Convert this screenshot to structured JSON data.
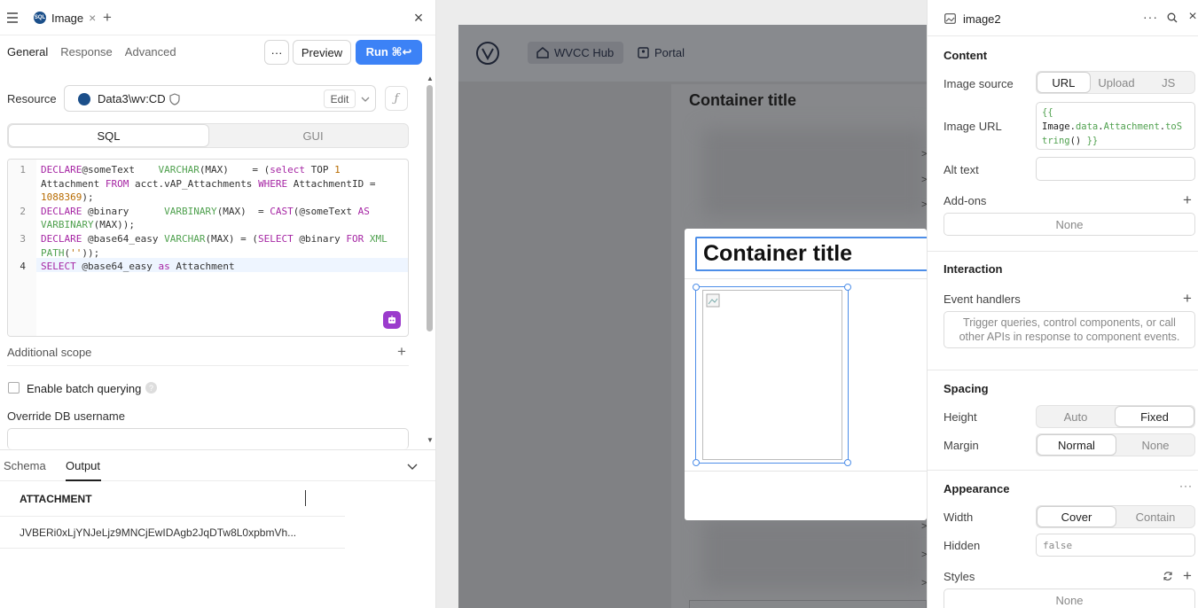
{
  "query_tab": {
    "badge": "SQL",
    "name": "Image"
  },
  "subtabs": [
    "General",
    "Response",
    "Advanced"
  ],
  "toolbar": {
    "more": "···",
    "preview": "Preview",
    "run": "Run ⌘↩"
  },
  "resource": {
    "label": "Resource",
    "value": "Data3\\wv:CD",
    "edit": "Edit"
  },
  "mode": {
    "sql": "SQL",
    "gui": "GUI"
  },
  "editor": {
    "line_numbers": [
      "1",
      "2",
      "3",
      "4"
    ],
    "lines": [
      [
        [
          "kw",
          "DECLARE"
        ],
        [
          "",
          "@someText    "
        ],
        [
          "ty",
          "VARCHAR"
        ],
        [
          "",
          "(MAX)    = ("
        ],
        [
          "kw",
          "select"
        ],
        [
          "",
          " TOP "
        ],
        [
          "num",
          "1"
        ]
      ],
      [
        [
          "",
          "Attachment "
        ],
        [
          "kw",
          "FROM"
        ],
        [
          "",
          " acct.vAP_Attachments "
        ],
        [
          "kw",
          "WHERE"
        ],
        [
          "",
          " AttachmentID ="
        ]
      ],
      [
        [
          "num",
          "1088369"
        ],
        [
          "",
          ");"
        ]
      ],
      [
        [
          "kw",
          "DECLARE"
        ],
        [
          "",
          " @binary      "
        ],
        [
          "ty",
          "VARBINARY"
        ],
        [
          "",
          "(MAX)  = "
        ],
        [
          "kw",
          "CAST"
        ],
        [
          "",
          "(@someText "
        ],
        [
          "kw",
          "AS"
        ]
      ],
      [
        [
          "ty",
          "VARBINARY"
        ],
        [
          "",
          "(MAX));"
        ]
      ],
      [
        [
          "kw",
          "DECLARE"
        ],
        [
          "",
          " @base64_easy "
        ],
        [
          "ty",
          "VARCHAR"
        ],
        [
          "",
          "(MAX) = ("
        ],
        [
          "kw",
          "SELECT"
        ],
        [
          "",
          " @binary "
        ],
        [
          "kw",
          "FOR"
        ],
        [
          "",
          " "
        ],
        [
          "ty",
          "XML"
        ]
      ],
      [
        [
          "ty",
          "PATH"
        ],
        [
          "",
          "("
        ],
        [
          "fn",
          "''"
        ],
        [
          "",
          "));"
        ]
      ],
      [
        [
          "kw",
          "SELECT"
        ],
        [
          "",
          " @base64_easy "
        ],
        [
          "kw",
          "as"
        ],
        [
          "",
          " Attachment"
        ]
      ]
    ]
  },
  "additional_scope": "Additional scope",
  "batch": "Enable batch querying",
  "override": "Override DB username",
  "output_tabs": {
    "schema": "Schema",
    "output": "Output"
  },
  "results": {
    "column": "ATTACHMENT",
    "row": "JVBERi0xLjYNJeLjz9MNCjEwIDAgb2JqDTw8L0xpbmVh..."
  },
  "canvas": {
    "hub": "WVCC Hub",
    "portal": "Portal",
    "container_title_bg": "Container title",
    "container_title": "Container title"
  },
  "inspector": {
    "name": "image2",
    "content": "Content",
    "image_source": {
      "label": "Image source",
      "options": [
        "URL",
        "Upload",
        "JS"
      ],
      "selected": "URL"
    },
    "image_url": {
      "label": "Image URL",
      "value_lines": [
        [
          "ty",
          "{{"
        ],
        [
          "",
          "Image."
        ],
        [
          "ty",
          "data"
        ],
        [
          "",
          "."
        ],
        [
          "ty",
          "Attachment"
        ],
        [
          "",
          "."
        ],
        [
          "ty",
          "toS"
        ]
      ],
      "value_line3": [
        [
          "ty",
          "tring"
        ],
        [
          "",
          "() "
        ],
        [
          "ty",
          "}}"
        ]
      ]
    },
    "alt_text": "Alt text",
    "addons": {
      "label": "Add-ons",
      "value": "None"
    },
    "interaction": "Interaction",
    "event_handlers": {
      "label": "Event handlers",
      "hint": "Trigger queries, control components, or call other APIs in response to component events."
    },
    "spacing": "Spacing",
    "height": {
      "label": "Height",
      "options": [
        "Auto",
        "Fixed"
      ],
      "selected": "Fixed"
    },
    "margin": {
      "label": "Margin",
      "options": [
        "Normal",
        "None"
      ],
      "selected": "Normal"
    },
    "appearance": "Appearance",
    "width": {
      "label": "Width",
      "options": [
        "Cover",
        "Contain"
      ],
      "selected": "Cover"
    },
    "hidden": {
      "label": "Hidden",
      "value": "false"
    },
    "styles": {
      "label": "Styles",
      "value": "None"
    }
  }
}
